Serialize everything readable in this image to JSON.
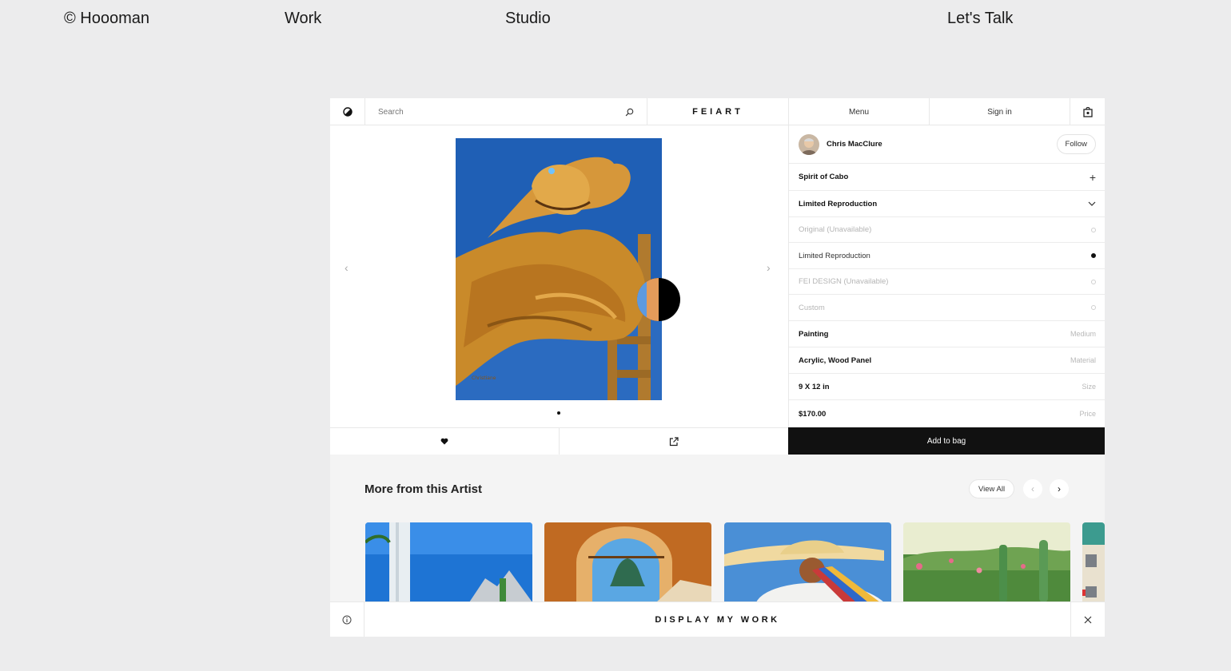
{
  "site_nav": {
    "brand": "© Hoooman",
    "work": "Work",
    "studio": "Studio",
    "talk": "Let's Talk"
  },
  "header": {
    "search_placeholder": "Search",
    "brand": "FEIART",
    "menu": "Menu",
    "sign_in": "Sign in"
  },
  "artist": {
    "name": "Chris MacClure",
    "follow_label": "Follow"
  },
  "product": {
    "title": "Spirit of Cabo",
    "edition_label": "Limited Reproduction",
    "options": [
      {
        "label": "Original (Unavailable)",
        "selected": false,
        "available": false
      },
      {
        "label": "Limited Reproduction",
        "selected": true,
        "available": true
      },
      {
        "label": "FEI DESIGN (Unavailable)",
        "selected": false,
        "available": false
      },
      {
        "label": "Custom",
        "selected": false,
        "available": false
      }
    ],
    "specs": [
      {
        "value": "Painting",
        "label": "Medium"
      },
      {
        "value": "Acrylic, Wood Panel",
        "label": "Material"
      },
      {
        "value": "9 X 12 in",
        "label": "Size"
      },
      {
        "value": "$170.00",
        "label": "Price"
      }
    ],
    "add_to_bag": "Add to bag"
  },
  "more": {
    "title": "More from this Artist",
    "view_all": "View All"
  },
  "banner": {
    "text": "DISPLAY MY WORK"
  },
  "colors": {
    "page_bg": "#ececed",
    "accent_dark": "#111111",
    "painting_sky": "#1f5fb5",
    "painting_ochre": "#c98a2a"
  },
  "icons": {
    "logo": "half-moon-icon",
    "search": "search-icon",
    "bag": "shopping-bag-icon",
    "like": "heart-icon",
    "share": "share-icon",
    "info": "info-icon",
    "close": "close-icon"
  }
}
